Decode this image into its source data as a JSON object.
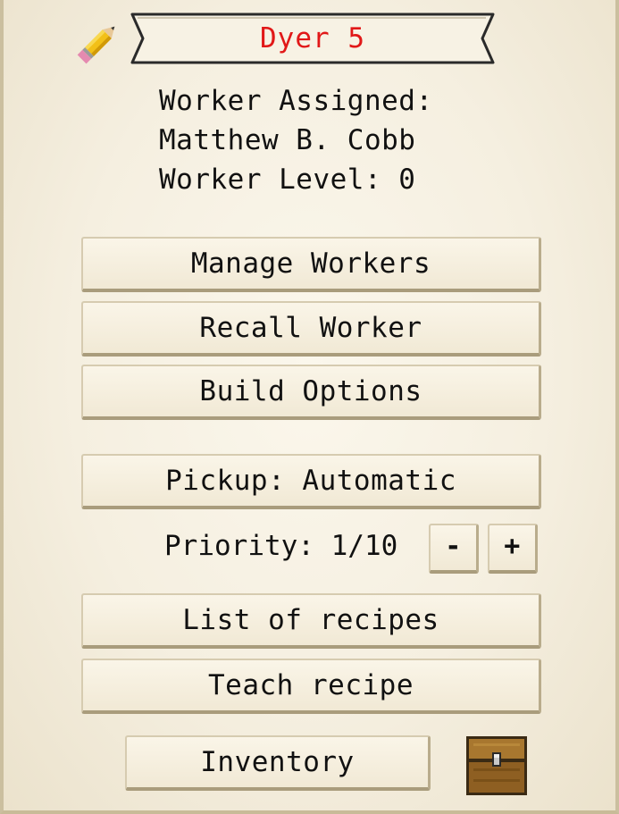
{
  "header": {
    "title": "Dyer 5",
    "title_color": "#e11818",
    "icon": "pencil-icon"
  },
  "worker": {
    "assigned_label": "Worker Assigned:",
    "name": "Matthew B. Cobb",
    "level": "Worker Level: 0"
  },
  "buttons": {
    "manage_workers": "Manage Workers",
    "recall_worker": "Recall Worker",
    "build_options": "Build Options",
    "pickup": "Pickup: Automatic",
    "list_recipes": "List of recipes",
    "teach_recipe": "Teach recipe",
    "inventory": "Inventory"
  },
  "priority": {
    "label": "Priority: 1/10",
    "minus": "-",
    "plus": "+"
  },
  "icons": {
    "chest": "chest-icon"
  }
}
